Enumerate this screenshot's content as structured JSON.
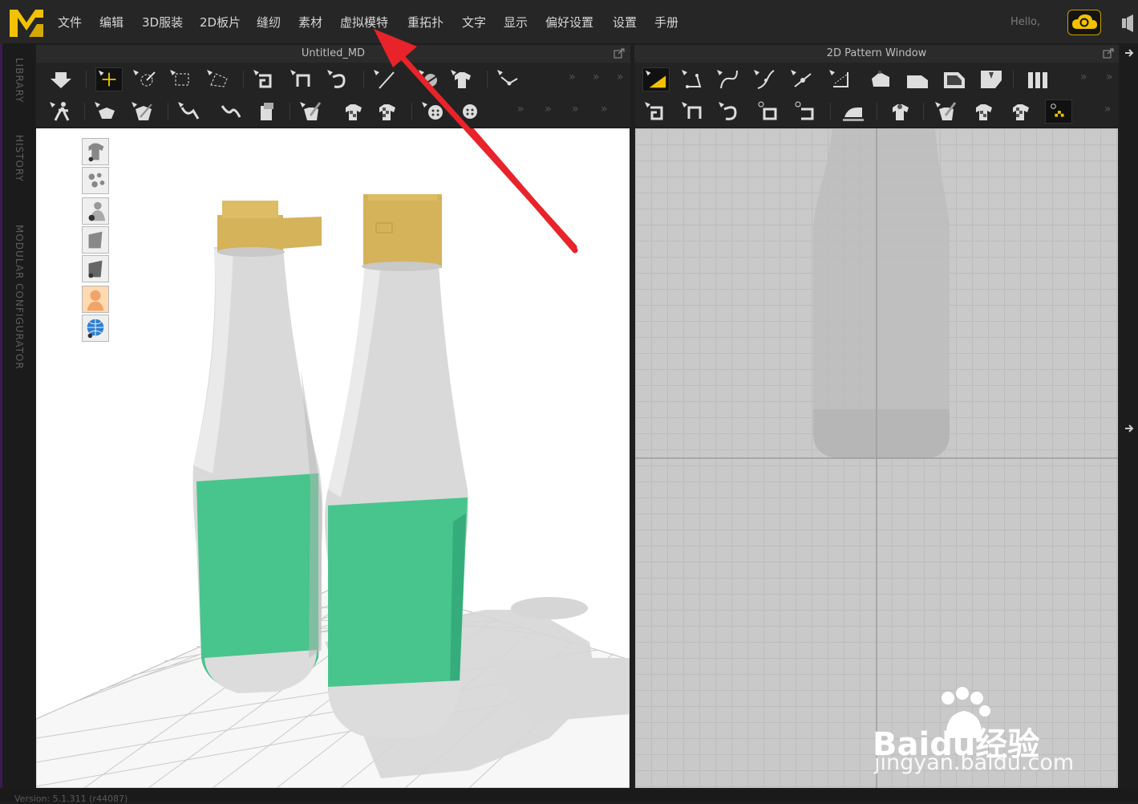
{
  "menu": [
    {
      "label": "文件"
    },
    {
      "label": "编辑"
    },
    {
      "label": "3D服装"
    },
    {
      "label": "2D板片"
    },
    {
      "label": "缝纫"
    },
    {
      "label": "素材"
    },
    {
      "label": "虚拟模特"
    },
    {
      "label": "重拓扑"
    },
    {
      "label": "文字"
    },
    {
      "label": "显示"
    },
    {
      "label": "偏好设置"
    },
    {
      "label": "设置"
    },
    {
      "label": "手册"
    }
  ],
  "user": {
    "greeting": "Hello,"
  },
  "side_tabs": {
    "library": "LIBRARY",
    "history": "HISTORY",
    "modular": "MODULAR CONFIGURATOR"
  },
  "panels": {
    "left_title": "Untitled_MD",
    "right_title": "2D Pattern Window"
  },
  "status": {
    "version": "Version: 5.1.311 (r44087)"
  },
  "watermark": {
    "brand": "Baidu经验",
    "url": "jingyan.baidu.com"
  },
  "colors": {
    "accent": "#f2c200",
    "annotation_arrow": "#e8232a",
    "cap": "#d4b35a",
    "label": "#4ac48f",
    "bottle": "#d6d6d6"
  }
}
